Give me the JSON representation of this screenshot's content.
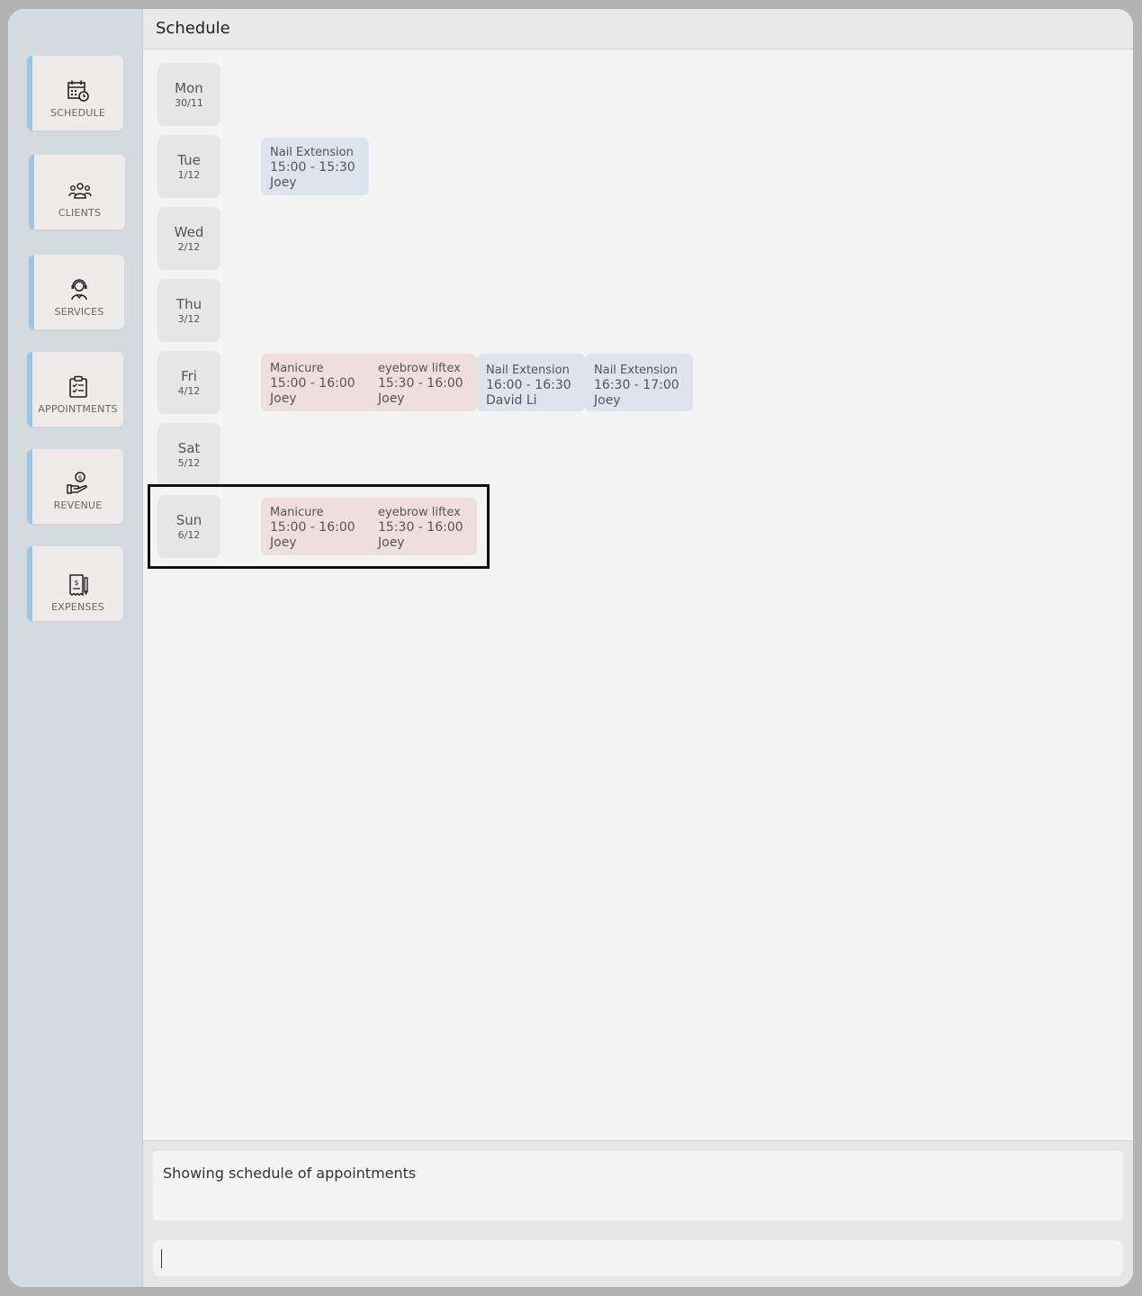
{
  "sidebar": {
    "items": [
      {
        "label": "SCHEDULE",
        "icon": "calendar-clock-icon"
      },
      {
        "label": "CLIENTS",
        "icon": "group-icon"
      },
      {
        "label": "SERVICES",
        "icon": "headset-person-icon"
      },
      {
        "label": "APPOINTMENTS",
        "icon": "clipboard-check-icon"
      },
      {
        "label": "REVENUE",
        "icon": "hand-coin-icon"
      },
      {
        "label": "EXPENSES",
        "icon": "receipt-pen-icon"
      }
    ]
  },
  "header": {
    "title": "Schedule"
  },
  "schedule": {
    "days": [
      {
        "name": "Mon",
        "date": "30/11"
      },
      {
        "name": "Tue",
        "date": "1/12"
      },
      {
        "name": "Wed",
        "date": "2/12"
      },
      {
        "name": "Thu",
        "date": "3/12"
      },
      {
        "name": "Fri",
        "date": "4/12"
      },
      {
        "name": "Sat",
        "date": "5/12"
      },
      {
        "name": "Sun",
        "date": "6/12"
      }
    ],
    "tue_appts": [
      {
        "service": "Nail Extension",
        "time": "15:00 - 15:30",
        "staff": "Joey"
      }
    ],
    "fri_appts": [
      {
        "service": "Manicure",
        "time": "15:00 - 16:00",
        "staff": "Joey"
      },
      {
        "service": "eyebrow liftex",
        "time": "15:30 - 16:00",
        "staff": "Joey"
      },
      {
        "service": "Nail Extension",
        "time": "16:00 - 16:30",
        "staff": "David Li"
      },
      {
        "service": "Nail Extension",
        "time": "16:30 - 17:00",
        "staff": "Joey"
      }
    ],
    "sun_appts": [
      {
        "service": "Manicure",
        "time": "15:00 - 16:00",
        "staff": "Joey"
      },
      {
        "service": "eyebrow liftex",
        "time": "15:30 - 16:00",
        "staff": "Joey"
      }
    ]
  },
  "result": {
    "text": "Showing schedule of appointments"
  },
  "command": {
    "value": "",
    "placeholder": ""
  },
  "colors": {
    "sidebar_bg": "#d4dbdf",
    "nav_accent": "#9fc4e2",
    "appt_pink": "#eedede",
    "appt_blue": "#dde4ee",
    "highlight_border": "#111111"
  }
}
